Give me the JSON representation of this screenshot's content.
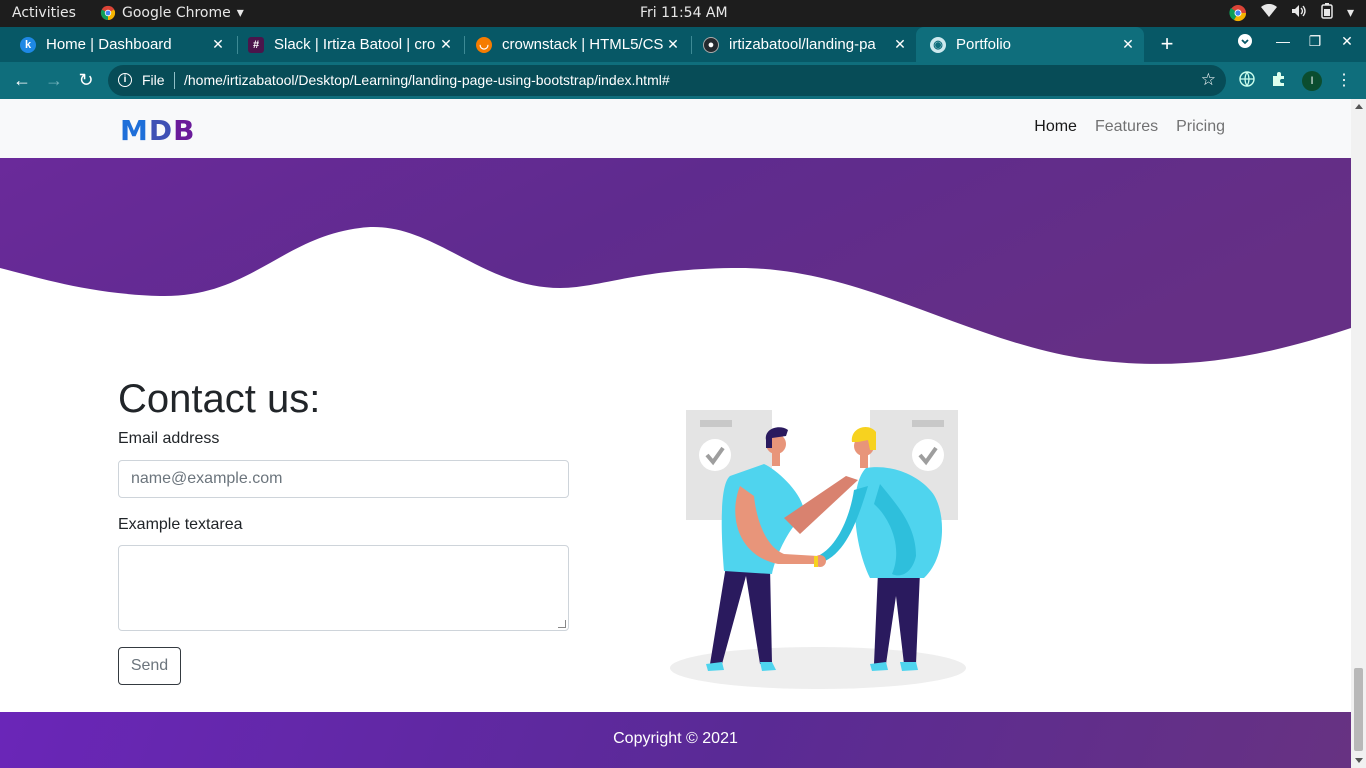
{
  "os_bar": {
    "activities": "Activities",
    "app_name": "Google Chrome",
    "clock": "Fri 11:54 AM"
  },
  "tabs": [
    {
      "title": "Home | Dashboard",
      "favicon": "k-letter-icon",
      "color": "#2196f3",
      "letter": "k"
    },
    {
      "title": "Slack | Irtiza Batool | cro",
      "favicon": "slack-icon",
      "color": "#4a154b",
      "letter": "#"
    },
    {
      "title": "crownstack | HTML5/CS",
      "favicon": "crownstack-icon",
      "color": "#f57c00",
      "letter": "~"
    },
    {
      "title": "irtizabatool/landing-pa",
      "favicon": "github-icon",
      "color": "#24292e",
      "letter": "●"
    },
    {
      "title": "Portfolio",
      "favicon": "globe-icon",
      "color": "#9fd8e0",
      "letter": "◉",
      "active": true
    }
  ],
  "toolbar": {
    "scheme": "File",
    "url": "/home/irtizabatool/Desktop/Learning/landing-page-using-bootstrap/index.html#",
    "profile_initial": "I"
  },
  "site": {
    "logo": {
      "m": "M",
      "d": "D",
      "b": "B"
    },
    "nav": [
      {
        "label": "Home",
        "active": true
      },
      {
        "label": "Features"
      },
      {
        "label": "Pricing"
      }
    ],
    "contact": {
      "heading": "Contact us:",
      "email_label": "Email address",
      "email_placeholder": "name@example.com",
      "textarea_label": "Example textarea",
      "send_label": "Send"
    },
    "footer": "Copyright © 2021",
    "colors": {
      "purple": "#63298f",
      "footer_start": "#6a26b8",
      "accent_cyan": "#5ce1f5",
      "navy": "#2a1a5e"
    }
  }
}
